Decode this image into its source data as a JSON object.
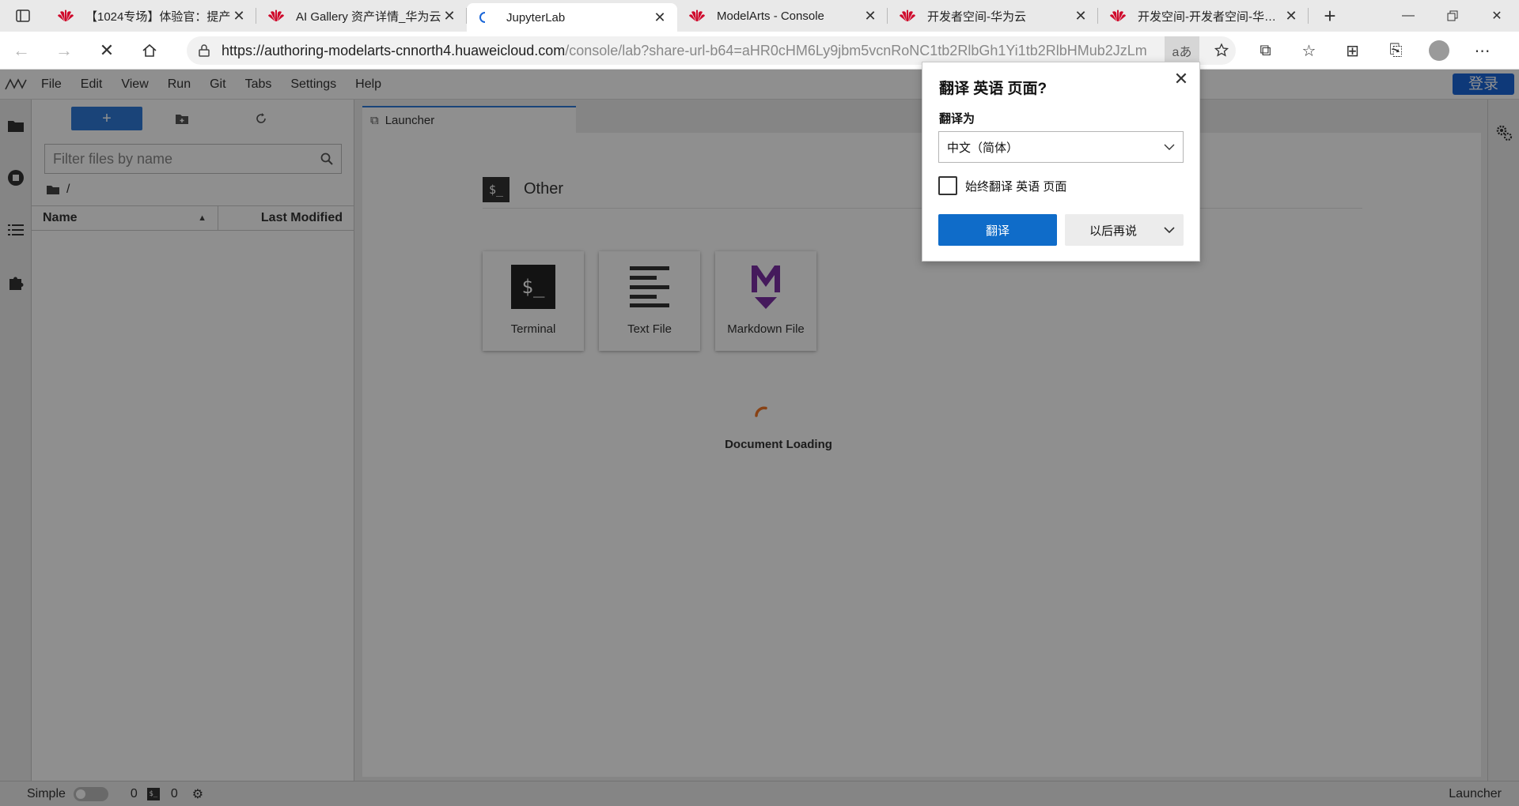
{
  "browser": {
    "tabs": [
      {
        "title": "【1024专场】体验官：提产",
        "favicon": "huawei-logo-icon"
      },
      {
        "title": "AI Gallery 资产详情_华为云",
        "favicon": "huawei-logo-icon"
      },
      {
        "title": "JupyterLab",
        "favicon": "jupyter-loading-icon",
        "active": true
      },
      {
        "title": "ModelArts - Console",
        "favicon": "huawei-logo-icon"
      },
      {
        "title": "开发者空间-华为云",
        "favicon": "huawei-logo-icon"
      },
      {
        "title": "开发空间-开发者空间-华为云",
        "favicon": "huawei-logo-icon"
      }
    ],
    "url_host": "https://authoring-modelarts-cnnorth4.huaweicloud.com",
    "url_rest": "/console/lab?share-url-b64=aHR0cHM6Ly9jbm5vcnRoNC1tb2RlbGh1Yi1tb2RlbHMub2JzLmNu...",
    "translate_glyph": "aあ"
  },
  "jupyter": {
    "menu": [
      "File",
      "Edit",
      "View",
      "Run",
      "Git",
      "Tabs",
      "Settings",
      "Help"
    ],
    "login_label": "登录",
    "filter_placeholder": "Filter files by name",
    "path": "/",
    "col_name": "Name",
    "col_modified": "Last Modified",
    "doc_tab": "Launcher",
    "section_title": "Other",
    "section_icon_text": "$_",
    "cards": [
      {
        "label": "Terminal",
        "icon": "terminal-icon"
      },
      {
        "label": "Text File",
        "icon": "text-file-icon"
      },
      {
        "label": "Markdown File",
        "icon": "markdown-icon"
      }
    ],
    "loading_text": "Document Loading",
    "status": {
      "mode_label": "Simple",
      "count_a": "0",
      "count_b": "0",
      "right_label": "Launcher"
    }
  },
  "translate_popup": {
    "title": "翻译 英语 页面?",
    "target_label": "翻译为",
    "target_value": "中文（简体）",
    "always_label": "始终翻译 英语 页面",
    "translate_button": "翻译",
    "later_button": "以后再说"
  },
  "colors": {
    "accent": "#0f6cc9",
    "jupyter_blue": "#2f7ad8",
    "huawei_red": "#cf0a2c",
    "markdown_purple": "#7b2fa5",
    "spinner": "#f37726"
  }
}
